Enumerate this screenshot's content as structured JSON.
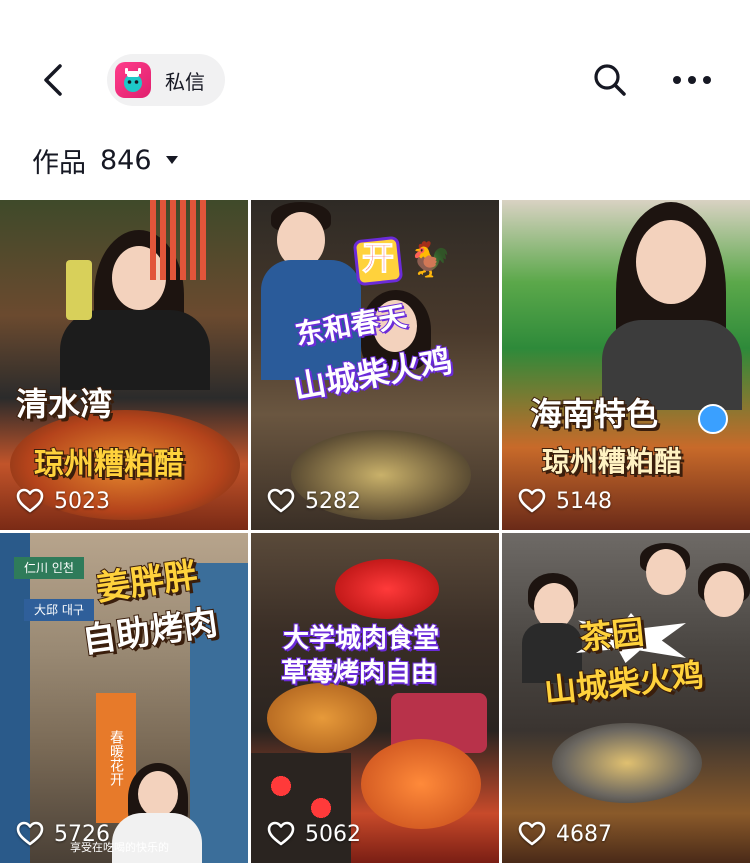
{
  "header": {
    "dm_label": "私信",
    "back_icon": "chevron-left-icon",
    "search_icon": "search-icon",
    "more_icon": "more-icon"
  },
  "works": {
    "label": "作品",
    "count": "846"
  },
  "videos": [
    {
      "caption_top": "清水湾",
      "caption_bottom": "琼州糟粕醋",
      "likes": "5023"
    },
    {
      "caption_badge": "开",
      "caption_line1": "东和春天",
      "caption_line2": "山城柴火鸡",
      "likes": "5282"
    },
    {
      "caption_top": "海南特色",
      "caption_bottom": "琼州糟粕醋",
      "likes": "5148"
    },
    {
      "caption_line1": "姜胖胖",
      "caption_line2": "自助烤肉",
      "sign_1": "仁川 인천",
      "sign_2": "大邱 대구",
      "sign_3": "春暖花开",
      "subtitle": "享受在吃喝的快乐的",
      "likes": "5726"
    },
    {
      "caption_line1": "大学城肉食堂",
      "caption_line2": "草莓烤肉自由",
      "likes": "5062"
    },
    {
      "caption_line1": "茶园",
      "caption_line2": "山城柴火鸡",
      "likes": "4687"
    }
  ],
  "colors": {
    "accent_pink": "#ff3d8b",
    "text_primary": "#161823",
    "pill_bg": "#f1f1f2",
    "caption_yellow": "#ffd23c",
    "caption_purple": "#6b2bd9"
  }
}
